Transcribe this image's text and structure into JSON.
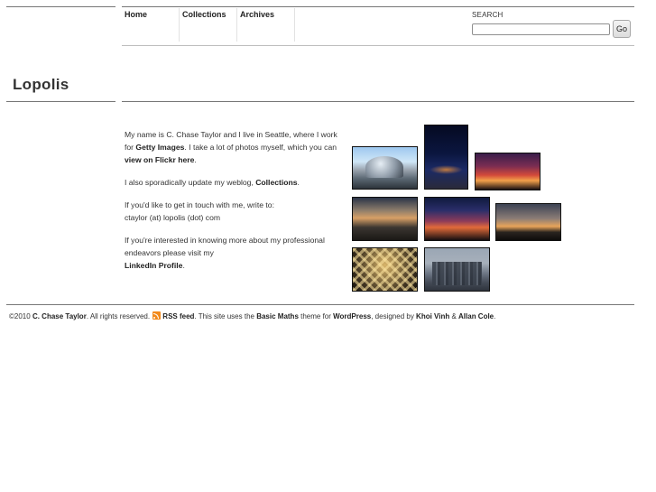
{
  "nav": {
    "items": [
      {
        "label": "Home"
      },
      {
        "label": "Collections"
      },
      {
        "label": "Archives"
      }
    ]
  },
  "search": {
    "label": "SEARCH",
    "value": "",
    "placeholder": "",
    "button_label": "Go"
  },
  "site": {
    "title": "Lopolis"
  },
  "intro": {
    "p1": {
      "t1": "My name is C. Chase Taylor and I live in Seattle, where I work for ",
      "link1": "Getty Images",
      "t2": ". I take a lot of photos myself, which you can ",
      "link2": "view on Flickr here",
      "t3": "."
    },
    "p2": {
      "t1": "I also sporadically update my weblog, ",
      "link1": "Collections",
      "t2": "."
    },
    "p3": {
      "line1": "If you'd like to get in touch with me, write to:",
      "line2": "ctaylor (at) lopolis (dot) com"
    },
    "p4": {
      "t1": "If you're interested in knowing more about my professional endeavors please visit my",
      "link1": "LinkedIn Profile",
      "t2": "."
    }
  },
  "photos": [
    {
      "name": "photo-cloud-gate"
    },
    {
      "name": "photo-night-city"
    },
    {
      "name": "photo-sunset-sky"
    },
    {
      "name": "photo-person-sunset"
    },
    {
      "name": "photo-dusk-clouds"
    },
    {
      "name": "photo-skyline-sunset"
    },
    {
      "name": "photo-lit-ceiling"
    },
    {
      "name": "photo-city-skyline"
    }
  ],
  "footer": {
    "copyright": "©2010",
    "author": "C. Chase Taylor",
    "rights": ". All rights reserved.",
    "rss_label": "RSS feed",
    "t1": ". This site uses the ",
    "theme": "Basic Maths",
    "t2": " theme for ",
    "platform": "WordPress",
    "t3": ", designed by ",
    "designer1": "Khoi Vinh",
    "amp": " & ",
    "designer2": "Allan Cole",
    "t4": "."
  }
}
